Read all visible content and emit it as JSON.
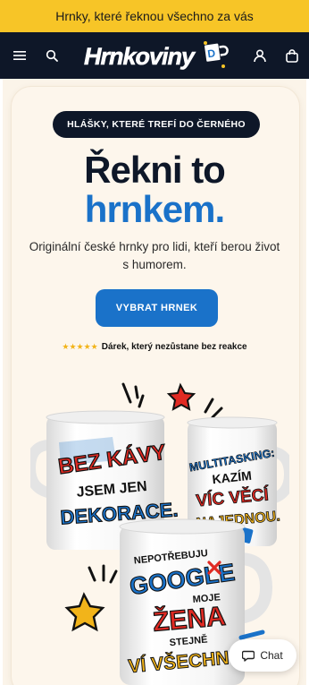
{
  "announcement": {
    "text": "Hrnky, které řeknou všechno za vás"
  },
  "header": {
    "logo_text": "Hrnkoviny",
    "icons": [
      "menu-icon",
      "search-icon",
      "account-icon",
      "cart-icon"
    ]
  },
  "hero": {
    "badge": "HLÁŠKY, KTERÉ TREFÍ DO ČERNÉHO",
    "title_line1": "Řekni to",
    "title_line2": "hrnkem.",
    "subtitle": "Originální české hrnky pro lidi, kteří berou život s humorem.",
    "cta_label": "VYBRAT HRNEK",
    "rating_stars": "★★★★★",
    "rating_text": "Dárek, který nezůstane bez reakce"
  },
  "mugs": [
    {
      "lines": [
        "BEZ KÁVY",
        "JSEM JEN",
        "DEKORACE."
      ]
    },
    {
      "lines": [
        "MULTITASKING:",
        "KAZÍM",
        "VÍC VĚCÍ",
        "NAJEDNOU."
      ]
    },
    {
      "lines": [
        "NEPOTŘEBUJU",
        "GOOGLE",
        "MOJE",
        "ŽENA",
        "STEJNĚ",
        "VÍ VŠECHNO"
      ]
    }
  ],
  "chat": {
    "label": "Chat"
  },
  "colors": {
    "announce_bg": "#f7c527",
    "header_bg": "#0e1728",
    "accent_blue": "#1a72c9",
    "cream": "#fdf6ec"
  }
}
